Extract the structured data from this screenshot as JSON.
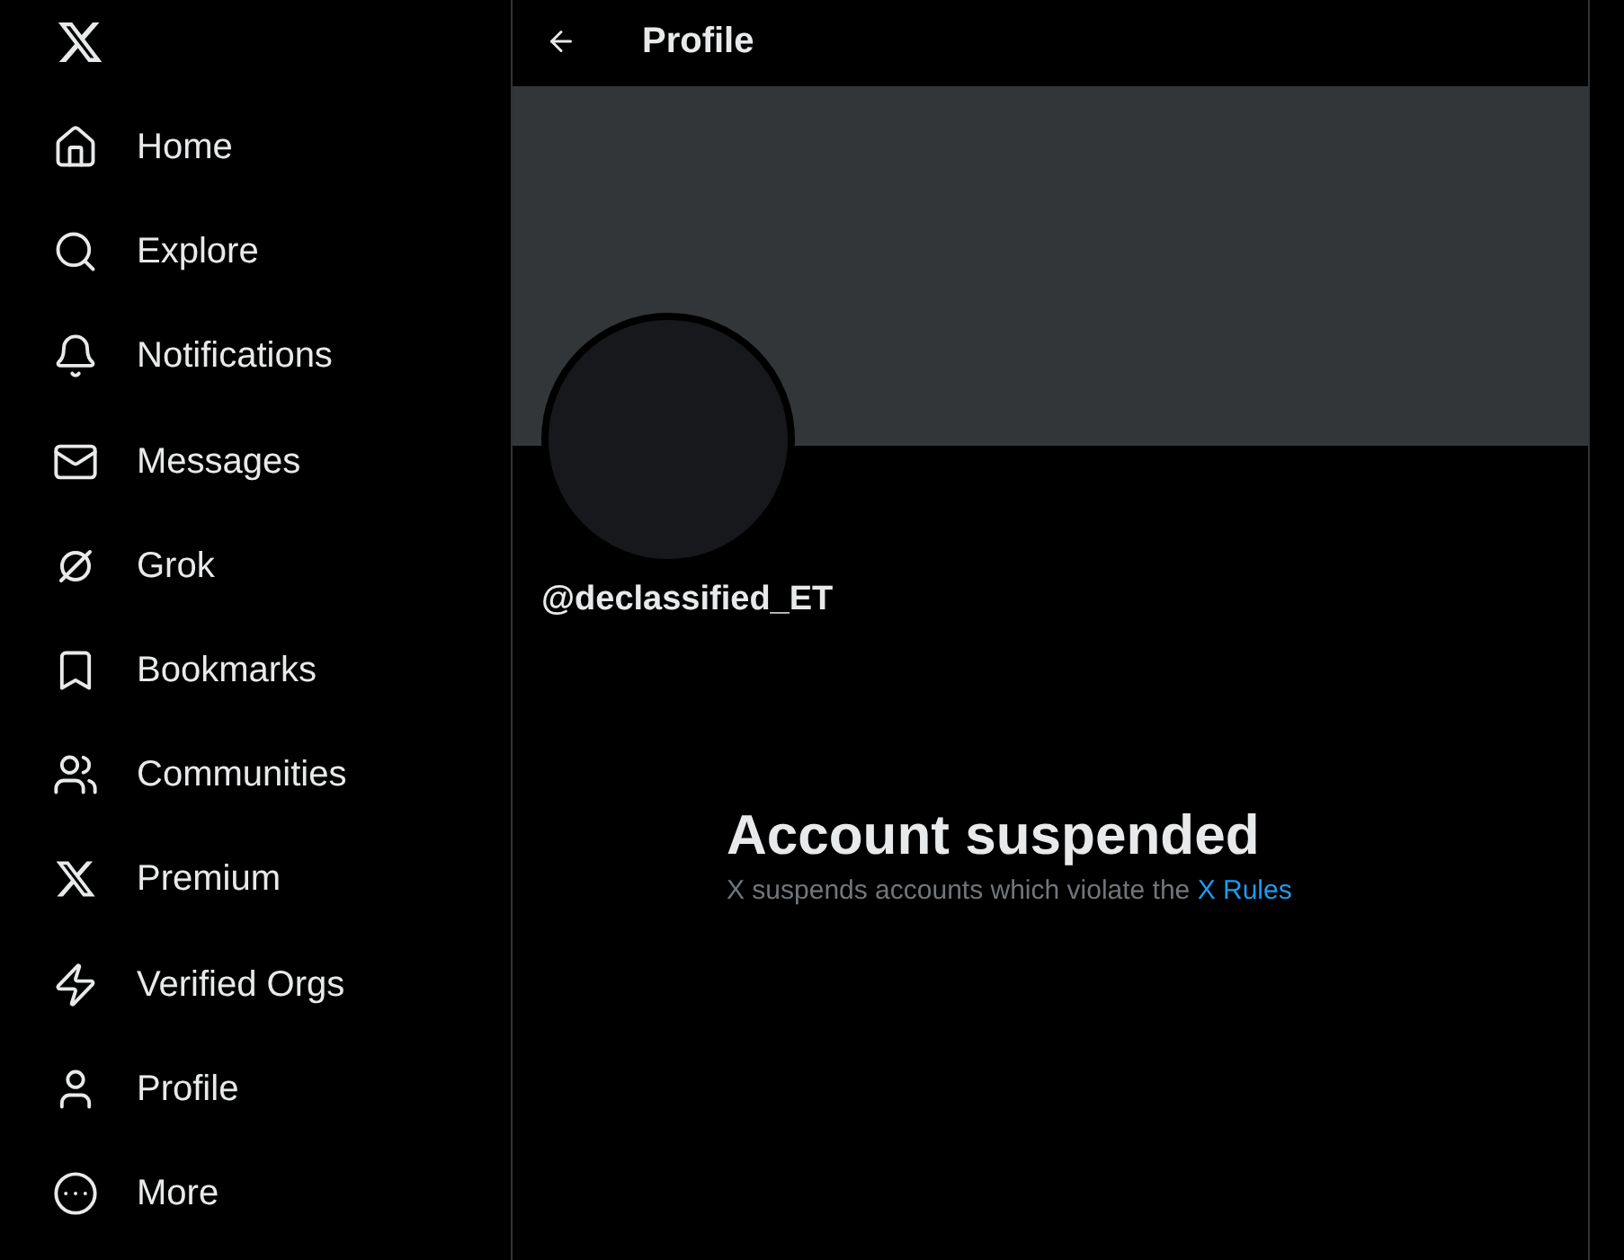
{
  "sidebar": {
    "items": [
      {
        "kind": "home",
        "label": "Home"
      },
      {
        "kind": "search",
        "label": "Explore"
      },
      {
        "kind": "bell",
        "label": "Notifications"
      },
      {
        "kind": "mail",
        "label": "Messages"
      },
      {
        "kind": "grok",
        "label": "Grok"
      },
      {
        "kind": "bookmark",
        "label": "Bookmarks"
      },
      {
        "kind": "people",
        "label": "Communities"
      },
      {
        "kind": "x",
        "label": "Premium"
      },
      {
        "kind": "bolt",
        "label": "Verified Orgs"
      },
      {
        "kind": "person",
        "label": "Profile"
      },
      {
        "kind": "more",
        "label": "More"
      }
    ]
  },
  "header": {
    "title": "Profile"
  },
  "profile": {
    "handle": "@declassified_ET"
  },
  "notice": {
    "title": "Account suspended",
    "text": "X suspends accounts which violate the",
    "link": "X Rules"
  }
}
